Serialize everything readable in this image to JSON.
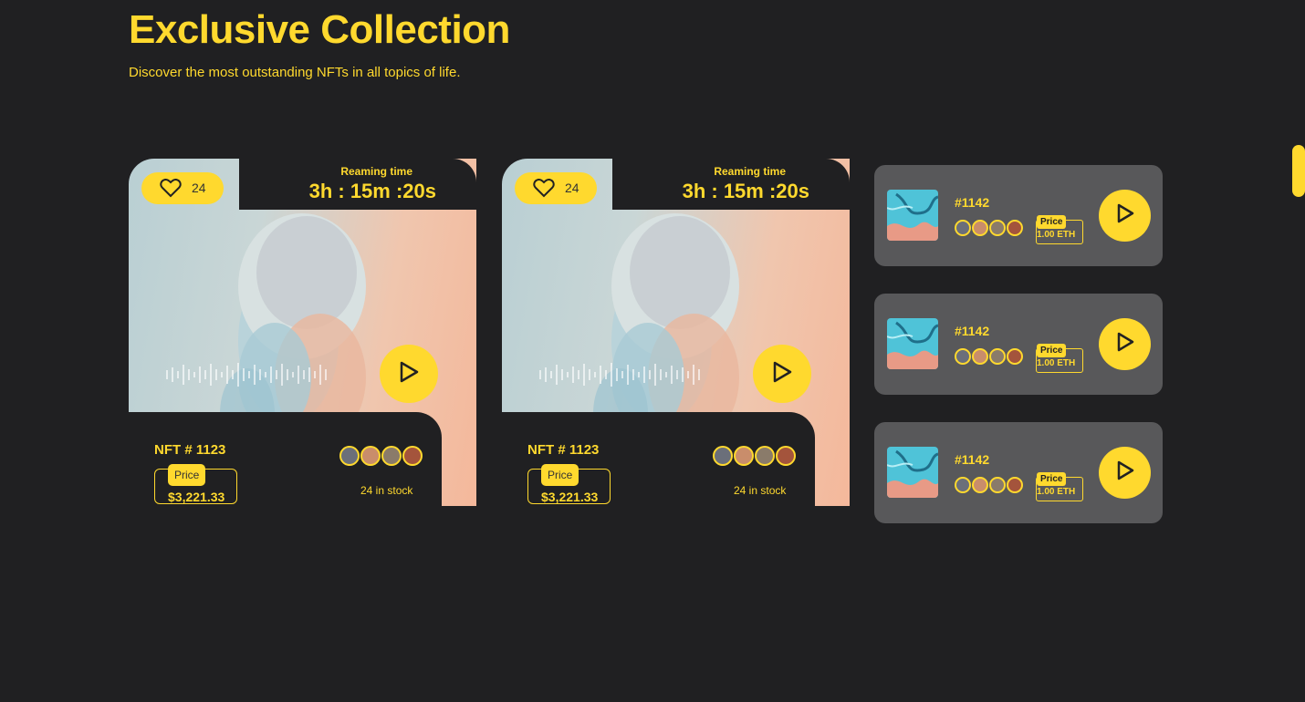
{
  "header": {
    "title": "Exclusive Collection",
    "subtitle": "Discover the most outstanding NFTs in all topics of life."
  },
  "featured_cards": [
    {
      "likes": "24",
      "remaining_label": "Reaming time",
      "remaining_time": "3h : 15m :20s",
      "name": "NFT # 1123",
      "price_label": "Price",
      "price": "$3,221.33",
      "stock": "24 in stock"
    },
    {
      "likes": "24",
      "remaining_label": "Reaming time",
      "remaining_time": "3h : 15m :20s",
      "name": "NFT # 1123",
      "price_label": "Price",
      "price": "$3,221.33",
      "stock": "24 in stock"
    }
  ],
  "list_cards": [
    {
      "name": "#1142",
      "price_label": "Price",
      "price": "1.00 ETH"
    },
    {
      "name": "#1142",
      "price_label": "Price",
      "price": "1.00 ETH"
    },
    {
      "name": "#1142",
      "price_label": "Price",
      "price": "1.00 ETH"
    }
  ],
  "icons": {
    "like": "heart-icon",
    "play": "play-icon"
  },
  "colors": {
    "background": "#202022",
    "accent": "#FFD92E",
    "list_card_bg": "#58585a"
  }
}
